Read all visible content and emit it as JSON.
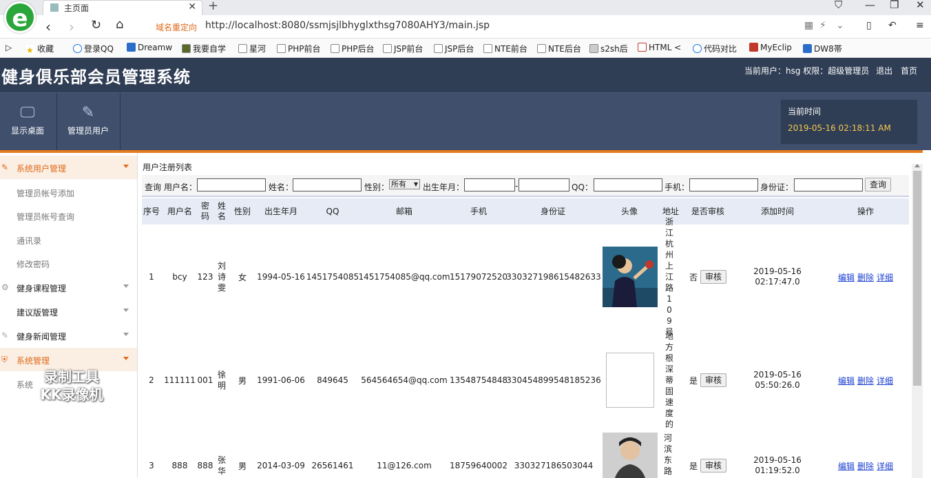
{
  "browser": {
    "tab_title": "主页面",
    "redirect_label": "域名重定向",
    "url": "http://localhost:8080/ssmjsjlbhyglxthsg7080AHY3/main.jsp",
    "bookmarks": [
      "收藏",
      "登录QQ",
      "Dreamw",
      "我要自学",
      "星河",
      "PHP前台",
      "PHP后台",
      "JSP前台",
      "JSP后台",
      "NTE前台",
      "NTE后台",
      "s2sh后",
      "HTML <",
      "代码对比",
      "MyEclip",
      "DW8帯"
    ]
  },
  "header": {
    "system_title": "健身俱乐部会员管理系统",
    "current_user_label": "当前用户：hsg 权限：超级管理员",
    "logout": "退出",
    "home": "首页"
  },
  "topnav": {
    "items": [
      {
        "label": "显示桌面",
        "icon": "monitor-icon"
      },
      {
        "label": "管理员用户",
        "icon": "pencil-icon"
      }
    ],
    "time_label": "当前时间",
    "time_value": "2019-05-16 02:18:11 AM"
  },
  "sidebar": {
    "groups": [
      {
        "label": "系统用户管理",
        "active": true
      },
      {
        "label": "健身课程管理"
      },
      {
        "label": "建议版管理"
      },
      {
        "label": "健身新闻管理"
      },
      {
        "label": "系统管理",
        "active": true
      }
    ],
    "sub_items": [
      "管理员帐号添加",
      "管理员帐号查询",
      "通讯录",
      "修改密码"
    ],
    "system_sub": "系统"
  },
  "watermark": {
    "line1": "录制工具",
    "line2": "KK录像机"
  },
  "content": {
    "list_title": "用户注册列表",
    "search": {
      "query_label": "查询",
      "username_label": "用户名：",
      "name_label": "姓名：",
      "gender_label": "性别：",
      "gender_value": "所有",
      "birth_label": "出生年月：",
      "birth_sep": "-",
      "qq_label": "QQ：",
      "phone_label": "手机：",
      "idcard_label": "身份证：",
      "button": "查询"
    },
    "columns": [
      "序号",
      "用户名",
      "密码",
      "姓名",
      "性别",
      "出生年月",
      "QQ",
      "邮箱",
      "手机",
      "身份证",
      "头像",
      "地址",
      "是否审核",
      "添加时间",
      "操作"
    ],
    "rows": [
      {
        "no": "1",
        "username": "bcy",
        "password": "123",
        "name": "刘诗雯",
        "gender": "女",
        "birth": "1994-05-16",
        "qq": "1451754085",
        "email": "1451754085@qq.com",
        "phone": "15179072520",
        "idcard": "330327198615482633",
        "address": "浙江杭州上江路109号",
        "audited": "否",
        "added_date": "2019-05-16",
        "added_time": "02:17:47.0"
      },
      {
        "no": "2",
        "username": "111111",
        "password": "001",
        "name": "徐明",
        "gender": "男",
        "birth": "1991-06-06",
        "qq": "849645",
        "email": "564564654@qq.com",
        "phone": "13548754848",
        "idcard": "330454899548185236",
        "address": "地方根深蒂固速度的",
        "audited": "是",
        "added_date": "2019-05-16",
        "added_time": "05:50:26.0"
      },
      {
        "no": "3",
        "username": "888",
        "password": "888",
        "name": "张华",
        "gender": "男",
        "birth": "2014-03-09",
        "qq": "26561461",
        "email": "11@126.com",
        "phone": "18759640002",
        "idcard": "330327186503044",
        "address": "河滨东路",
        "audited": "是",
        "added_date": "2019-05-16",
        "added_time": "01:19:52.0"
      }
    ],
    "audit_button": "审核",
    "actions": [
      "编辑",
      "删除",
      "详细"
    ]
  }
}
